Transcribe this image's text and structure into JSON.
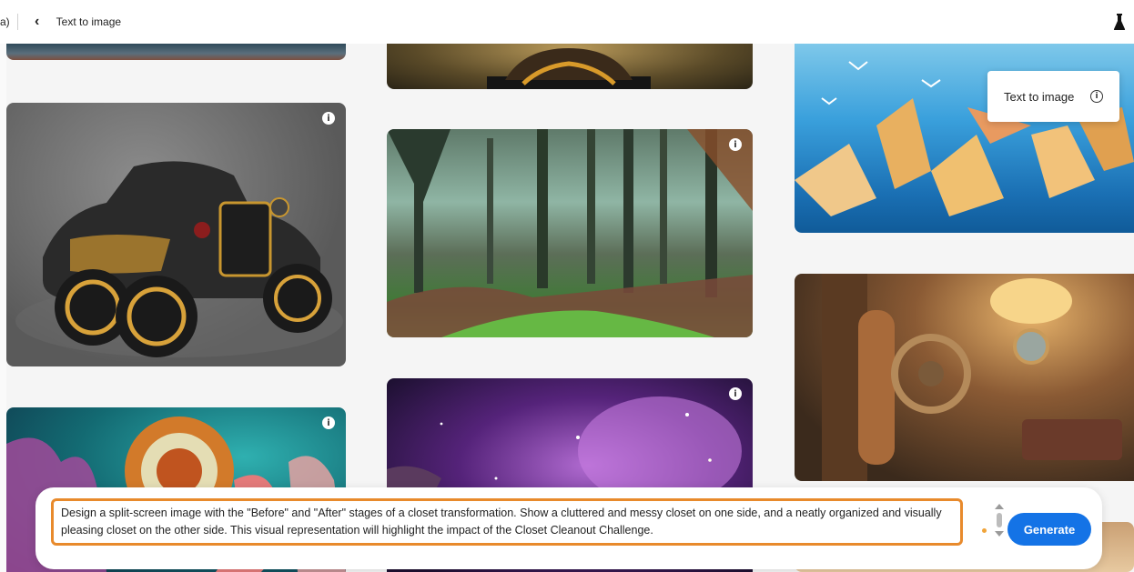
{
  "topbar": {
    "app_fragment": "a)",
    "back_icon": "chevron-left-icon",
    "title": "Text to image",
    "labs_icon": "flask-icon"
  },
  "tooltip": {
    "label": "Text to image",
    "icon": "info-icon"
  },
  "gallery": {
    "info_glyph": "i",
    "cards": [
      {
        "id": "left-1",
        "subject": ""
      },
      {
        "id": "left-2",
        "subject": "vintage car"
      },
      {
        "id": "left-3",
        "subject": "seahorse and coral"
      },
      {
        "id": "mid-1",
        "subject": "ornate figurine"
      },
      {
        "id": "mid-2",
        "subject": "misty forest"
      },
      {
        "id": "mid-3",
        "subject": "galaxy nebula"
      },
      {
        "id": "right-1",
        "subject": "origami cranes over ocean"
      },
      {
        "id": "right-2",
        "subject": "steampunk room"
      },
      {
        "id": "right-3",
        "subject": ""
      }
    ]
  },
  "prompt": {
    "text": "Design a split-screen image with the \"Before\" and \"After\" stages of a closet transformation. Show a cluttered and messy closet on one side, and a neatly organized and visually pleasing closet on the other side. This visual representation will highlight the impact of the Closet Cleanout Challenge."
  },
  "generate_button": {
    "label": "Generate"
  },
  "colors": {
    "accent": "#1473e6",
    "prompt_border": "#e88a2c"
  }
}
